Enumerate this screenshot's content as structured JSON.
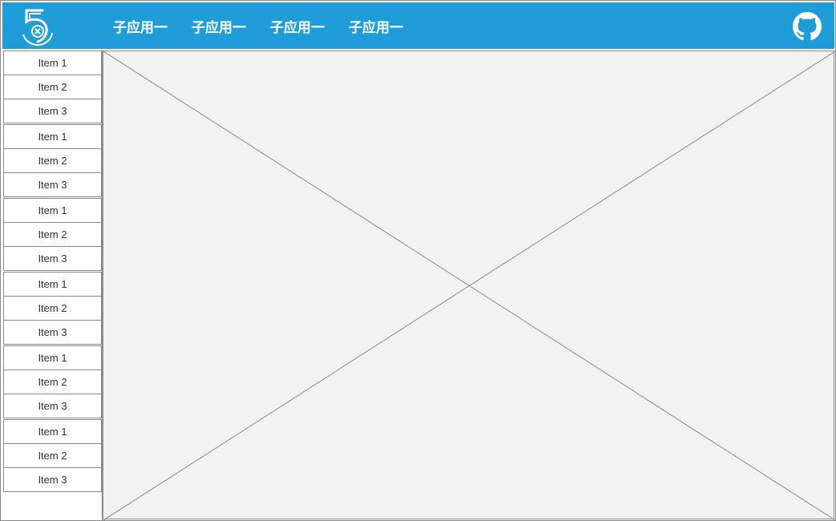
{
  "header": {
    "nav": [
      "子应用一",
      "子应用一",
      "子应用一",
      "子应用一"
    ],
    "background": "#1f9dd9"
  },
  "sidebar": {
    "groups": [
      {
        "items": [
          "Item 1",
          "Item 2",
          "Item 3"
        ]
      },
      {
        "items": [
          "Item 1",
          "Item 2",
          "Item 3"
        ]
      },
      {
        "items": [
          "Item 1",
          "Item 2",
          "Item 3"
        ]
      },
      {
        "items": [
          "Item 1",
          "Item 2",
          "Item 3"
        ]
      },
      {
        "items": [
          "Item 1",
          "Item 2",
          "Item 3"
        ]
      },
      {
        "items": [
          "Item 1",
          "Item 2",
          "Item 3"
        ]
      }
    ]
  },
  "icons": {
    "logo": "logo-icon",
    "github": "github-icon"
  }
}
